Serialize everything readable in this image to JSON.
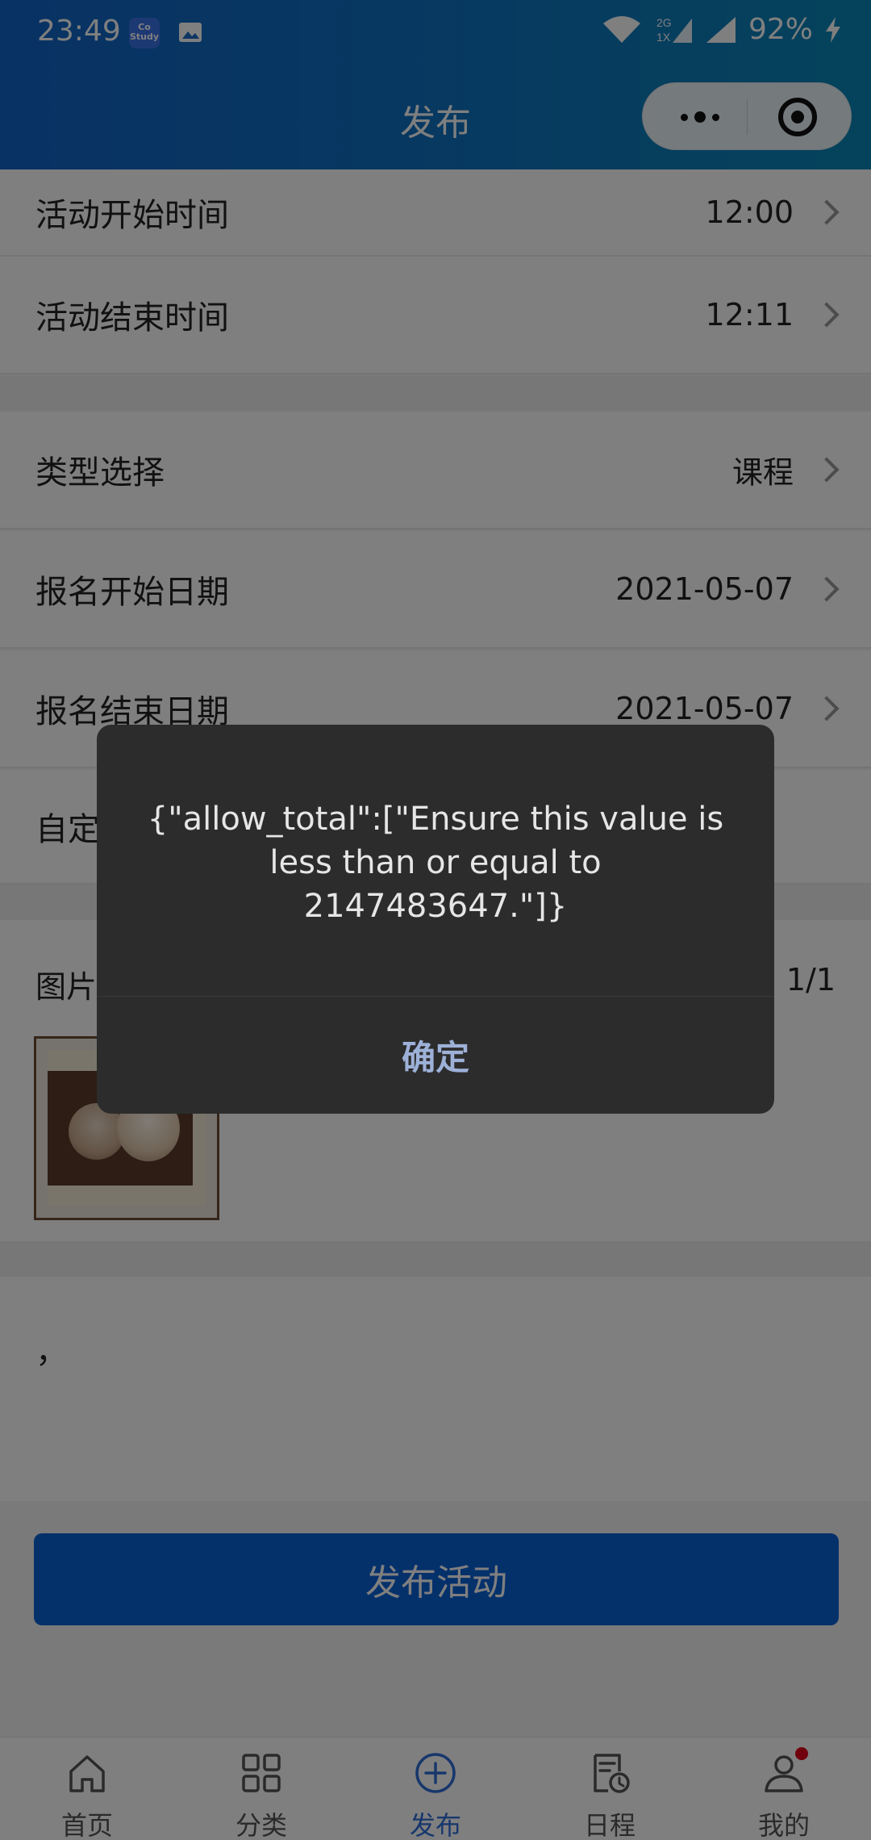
{
  "status": {
    "time": "23:49",
    "network": "2G 1X",
    "battery": "92%",
    "app_badge": "Co Study"
  },
  "header": {
    "title": "发布"
  },
  "form": {
    "rows_top": [
      {
        "label": "活动开始时间",
        "value": "12:00"
      },
      {
        "label": "活动结束时间",
        "value": "12:11"
      }
    ],
    "rows_mid": [
      {
        "label": "类型选择",
        "value": "课程"
      },
      {
        "label": "报名开始日期",
        "value": "2021-05-07"
      },
      {
        "label": "报名结束日期",
        "value": "2021-05-07"
      },
      {
        "label": "自定义",
        "value": ""
      }
    ],
    "image_label": "图片",
    "image_count": "1/1",
    "description": "，"
  },
  "publish_button": "发布活动",
  "tabbar": [
    {
      "label": "首页",
      "icon": "home-icon"
    },
    {
      "label": "分类",
      "icon": "grid-icon"
    },
    {
      "label": "发布",
      "icon": "plus-circle-icon",
      "active": true
    },
    {
      "label": "日程",
      "icon": "schedule-icon"
    },
    {
      "label": "我的",
      "icon": "user-icon",
      "badge": true
    }
  ],
  "dialog": {
    "message": "{\"allow_total\":[\"Ensure this value is less than or equal to 2147483647.\"]}",
    "confirm": "确定"
  },
  "colors": {
    "primary": "#0b62d6",
    "tab_active": "#2f6fd8",
    "badge": "#e0001b"
  }
}
